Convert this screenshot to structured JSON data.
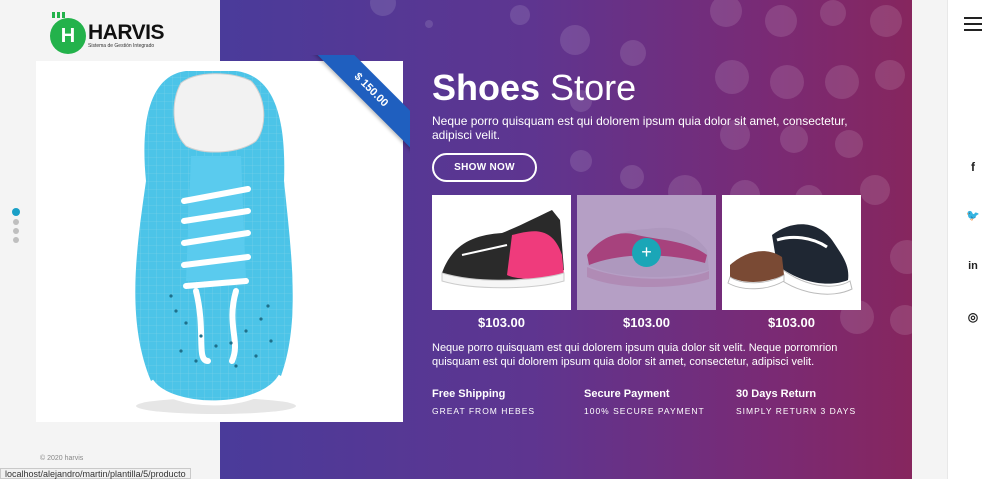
{
  "brand": {
    "name": "HARVIS",
    "tagline": "Sistema de Gestión Integrado"
  },
  "product": {
    "price_badge": "$ 150.00"
  },
  "slider": {
    "dots": 4,
    "active_index": 0
  },
  "hero": {
    "title_bold": "Shoes",
    "title_light": " Store",
    "description": "Neque porro quisquam est qui dolorem ipsum quia dolor sit amet, consectetur, adipisci velit.",
    "cta_label": "SHOW NOW",
    "thumbnails": [
      {
        "price": "$103.00",
        "icon": "sneaker-pink-icon"
      },
      {
        "price": "$103.00",
        "icon": "sneaker-pink-white-icon",
        "hover_action": "+"
      },
      {
        "price": "$103.00",
        "icon": "sneaker-black-icon"
      }
    ],
    "description2": "Neque porro quisquam est qui dolorem ipsum quia dolor sit velit. Neque porromrion quisquam est qui dolorem ipsum quia dolor sit amet, consectetur, adipisci velit.",
    "features": [
      {
        "title": "Free Shipping",
        "subtitle": "GREAT FROM HEBES"
      },
      {
        "title": "Secure Payment",
        "subtitle": "100% SECURE PAYMENT"
      },
      {
        "title": "30 Days Return",
        "subtitle": "SIMPLY RETURN 3 DAYS"
      }
    ]
  },
  "footer": {
    "copyright": "© 2020 harvis"
  },
  "status_url": "localhost/alejandro/martin/plantilla/5/producto",
  "social": [
    {
      "label": "f",
      "icon": "facebook-icon"
    },
    {
      "label": "🐦",
      "icon": "twitter-icon"
    },
    {
      "label": "in",
      "icon": "linkedin-icon"
    },
    {
      "label": "◎",
      "icon": "instagram-icon"
    }
  ],
  "colors": {
    "accent": "#1aa6b7",
    "brand_green": "#23b24b",
    "ribbon": "#1f5fbf",
    "hero_start": "#4a3b9a",
    "hero_end": "#86265e"
  }
}
